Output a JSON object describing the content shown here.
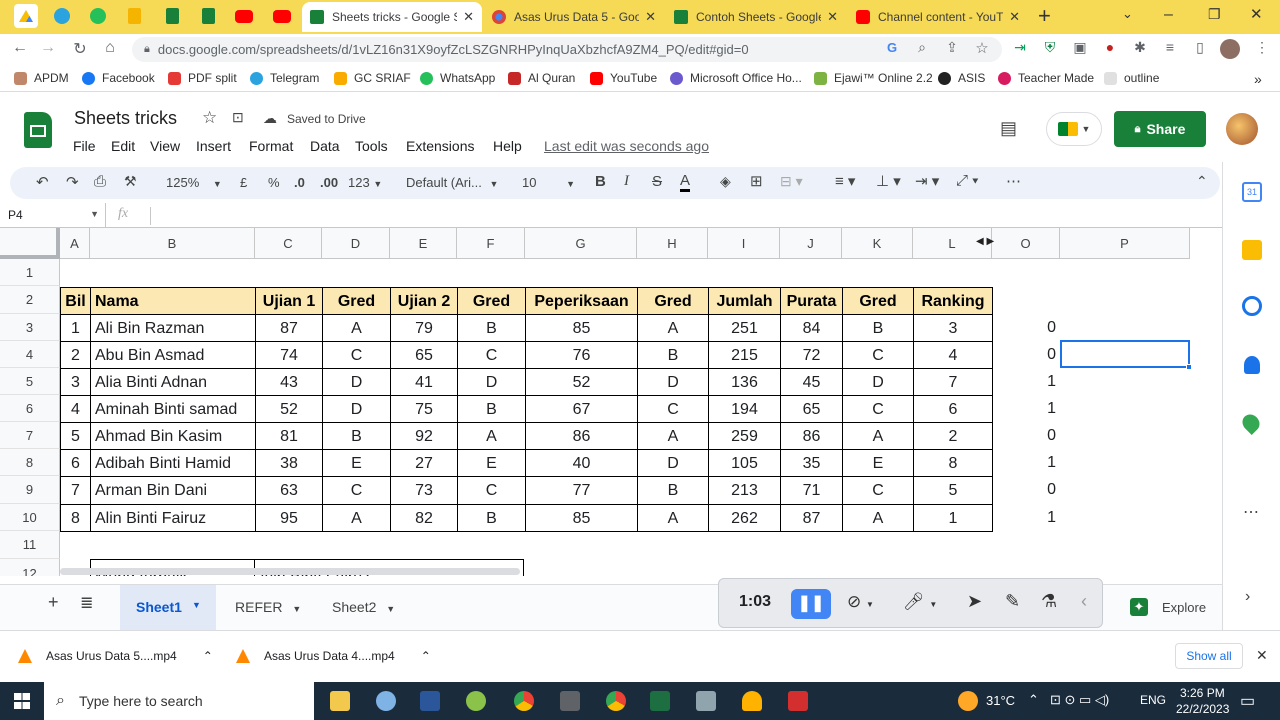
{
  "browser": {
    "tabs": [
      {
        "title": "Sheets tricks - Google Sh",
        "active": true
      },
      {
        "title": "Asas Urus Data 5 - Goog",
        "active": false
      },
      {
        "title": "Contoh Sheets - Google",
        "active": false
      },
      {
        "title": "Channel content - YouTu",
        "active": false
      }
    ],
    "new_tab_icon": "plus-icon",
    "url": "docs.google.com/spreadsheets/d/1vLZ16n31X9oyfZcLSZGNRHPyInqUaXbzhcfA9ZM4_PQ/edit#gid=0",
    "bookmarks": [
      "APDM",
      "Facebook",
      "PDF split",
      "Telegram",
      "GC SRIAF",
      "WhatsApp",
      "Al Quran",
      "YouTube",
      "Microsoft Office Ho...",
      "Ejawi™ Online 2.2",
      "ASIS",
      "Teacher Made",
      "outline"
    ]
  },
  "doc": {
    "title": "Sheets tricks",
    "save_status": "Saved to Drive",
    "menu": [
      "File",
      "Edit",
      "View",
      "Insert",
      "Format",
      "Data",
      "Tools",
      "Extensions",
      "Help"
    ],
    "last_edit": "Last edit was seconds ago",
    "share_label": "Share"
  },
  "toolbar": {
    "zoom": "125%",
    "currency": "£",
    "percent": "%",
    "dec_decrease": ".0",
    "dec_increase": ".00",
    "format_more": "123",
    "font": "Default (Ari...",
    "font_size": "10",
    "bold": "B",
    "italic": "I",
    "strike": "S",
    "text_color": "A",
    "more": "⋯"
  },
  "formula_bar": {
    "name_box": "P4",
    "fx": "fx",
    "value": ""
  },
  "grid": {
    "columns": [
      "A",
      "B",
      "C",
      "D",
      "E",
      "F",
      "G",
      "H",
      "I",
      "J",
      "K",
      "L",
      "O",
      "P"
    ],
    "rows": [
      "1",
      "2",
      "3",
      "4",
      "5",
      "6",
      "7",
      "8",
      "9",
      "10",
      "11",
      "12"
    ],
    "headers": [
      "Bil",
      "Nama",
      "Ujian 1",
      "Gred",
      "Ujian 2",
      "Gred",
      "Peperiksaan",
      "Gred",
      "Jumlah",
      "Purata",
      "Gred",
      "Ranking"
    ],
    "data": [
      [
        "1",
        "Ali Bin Razman",
        "87",
        "A",
        "79",
        "B",
        "85",
        "A",
        "251",
        "84",
        "B",
        "3",
        "0"
      ],
      [
        "2",
        "Abu Bin Asmad",
        "74",
        "C",
        "65",
        "C",
        "76",
        "B",
        "215",
        "72",
        "C",
        "4",
        "0"
      ],
      [
        "3",
        "Alia Binti Adnan",
        "43",
        "D",
        "41",
        "D",
        "52",
        "D",
        "136",
        "45",
        "D",
        "7",
        "1"
      ],
      [
        "4",
        "Aminah Binti samad",
        "52",
        "D",
        "75",
        "B",
        "67",
        "C",
        "194",
        "65",
        "C",
        "6",
        "1"
      ],
      [
        "5",
        "Ahmad Bin Kasim",
        "81",
        "B",
        "92",
        "A",
        "86",
        "A",
        "259",
        "86",
        "A",
        "2",
        "0"
      ],
      [
        "6",
        "Adibah Binti Hamid",
        "38",
        "E",
        "27",
        "E",
        "40",
        "D",
        "105",
        "35",
        "E",
        "8",
        "1"
      ],
      [
        "7",
        "Arman Bin Dani",
        "63",
        "C",
        "73",
        "C",
        "77",
        "B",
        "213",
        "71",
        "C",
        "5",
        "0"
      ],
      [
        "8",
        "Alin Binti Fairuz",
        "95",
        "A",
        "82",
        "B",
        "85",
        "A",
        "262",
        "87",
        "A",
        "1",
        "1"
      ]
    ],
    "best_label": "Murid terbaik",
    "best_value": "Alin Binti Fairuz",
    "selected_cell": "P4"
  },
  "sheets": {
    "add_icon": "plus-icon",
    "list_icon": "menu-icon",
    "tabs": [
      {
        "name": "Sheet1",
        "active": true
      },
      {
        "name": "REFER",
        "active": false
      },
      {
        "name": "Sheet2",
        "active": false
      }
    ],
    "explore": "Explore"
  },
  "recorder": {
    "time": "1:03"
  },
  "downloads": {
    "items": [
      "Asas Urus Data 5....mp4",
      "Asas Urus Data 4....mp4"
    ],
    "show_all": "Show all"
  },
  "taskbar": {
    "search_placeholder": "Type here to search",
    "temperature": "31°C",
    "language": "ENG",
    "time": "3:26 PM",
    "date": "22/2/2023"
  },
  "colors": {
    "accent_green": "#188038",
    "header_fill": "#fce8b2",
    "chrome_tab": "#f6da55"
  }
}
